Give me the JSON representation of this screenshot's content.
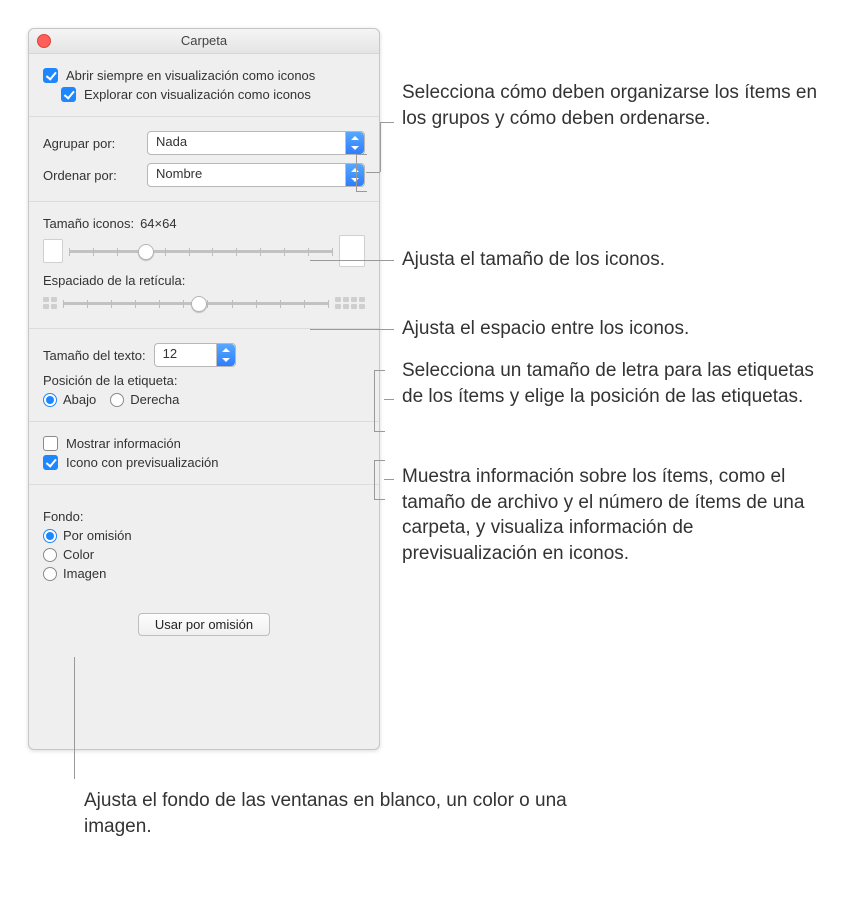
{
  "window": {
    "title": "Carpeta"
  },
  "view": {
    "always_open_icons": "Abrir siempre en visualización como iconos",
    "browse_icons": "Explorar con visualización como iconos"
  },
  "organize": {
    "group_by_label": "Agrupar por:",
    "group_by_value": "Nada",
    "sort_by_label": "Ordenar por:",
    "sort_by_value": "Nombre"
  },
  "icon_size": {
    "label": "Tamaño iconos:",
    "value": "64×64",
    "grid_label": "Espaciado de la retícula:"
  },
  "text": {
    "size_label": "Tamaño del texto:",
    "size_value": "12",
    "position_label": "Posición de la etiqueta:",
    "pos_bottom": "Abajo",
    "pos_right": "Derecha"
  },
  "info": {
    "show_info": "Mostrar información",
    "preview_icon": "Icono con previsualización"
  },
  "background": {
    "label": "Fondo:",
    "default": "Por omisión",
    "color": "Color",
    "image": "Imagen"
  },
  "button": {
    "use_defaults": "Usar por omisión"
  },
  "annotations": {
    "organize": "Selecciona cómo deben organizarse los ítems en los grupos y cómo deben ordenarse.",
    "icon_size": "Ajusta el tamaño de los iconos.",
    "grid_spacing": "Ajusta el espacio entre los iconos.",
    "text_labels": "Selecciona un tamaño de letra para las etiquetas de los ítems y elige la posición de las etiquetas.",
    "info_preview": "Muestra información sobre los ítems, como el tamaño de archivo y el número de ítems de una carpeta, y visualiza información de previsualización en iconos.",
    "background": "Ajusta el fondo de las ventanas en blanco, un color o una imagen."
  }
}
